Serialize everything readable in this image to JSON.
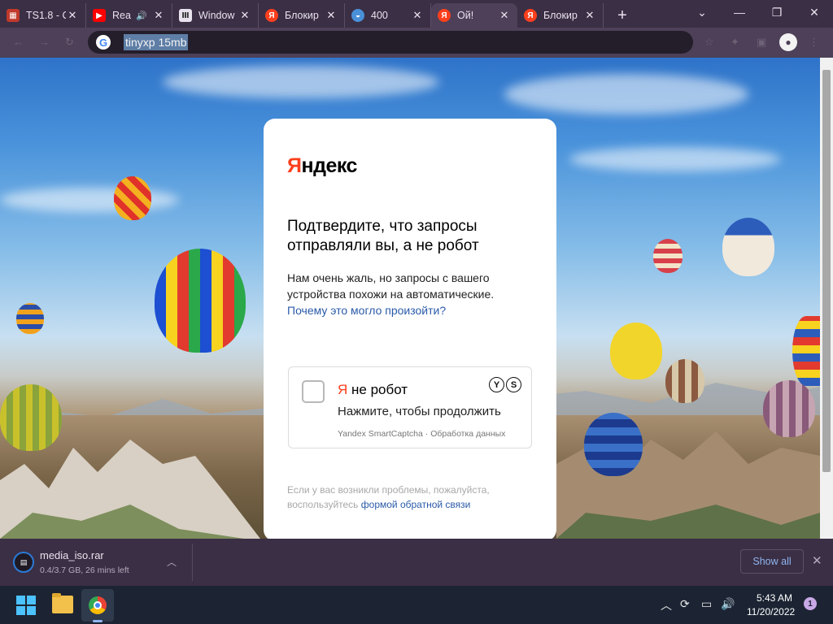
{
  "browser": {
    "tabs": [
      {
        "title": "TS1.8 - С",
        "favicon": "ts-favicon",
        "color": "#c0392b"
      },
      {
        "title": "Rea",
        "favicon": "youtube-favicon",
        "color": "#ff0000",
        "audio": "🔊"
      },
      {
        "title": "Window",
        "favicon": "archive-favicon",
        "color": "#555555"
      },
      {
        "title": "Блокир",
        "favicon": "yandex-favicon",
        "color": "#fc3f1d"
      },
      {
        "title": "400",
        "favicon": "generic-favicon",
        "color": "#4a90d9"
      },
      {
        "title": "Ой!",
        "favicon": "yandex-favicon",
        "color": "#fc3f1d"
      },
      {
        "title": "Блокир",
        "favicon": "yandex-favicon",
        "color": "#fc3f1d"
      }
    ],
    "url": "tinyxp 15mb"
  },
  "captcha_page": {
    "logo_red": "Я",
    "logo_rest": "ндекс",
    "heading": "Подтвердите, что запросы отправляли вы, а не робот",
    "body": "Нам очень жаль, но запросы с вашего устройства похожи на автоматические. ",
    "body_link": "Почему это могло произойти?",
    "captcha": {
      "title_red": "Я",
      "title_rest": " не робот",
      "subtitle": "Нажмите, чтобы продолжить",
      "footer": "Yandex SmartCaptcha · Обработка данных",
      "brand_glyphs": [
        "Y",
        "S"
      ]
    },
    "help_text": "Если у вас возникли проблемы, пожалуйста, воспользуйтесь ",
    "help_link": "формой обратной связи"
  },
  "downloads": {
    "file_name": "media_iso.rar",
    "status": "0.4/3.7 GB, 26 mins left",
    "show_all": "Show all"
  },
  "taskbar": {
    "time": "5:43 AM",
    "date": "11/20/2022",
    "notifications": "1"
  }
}
